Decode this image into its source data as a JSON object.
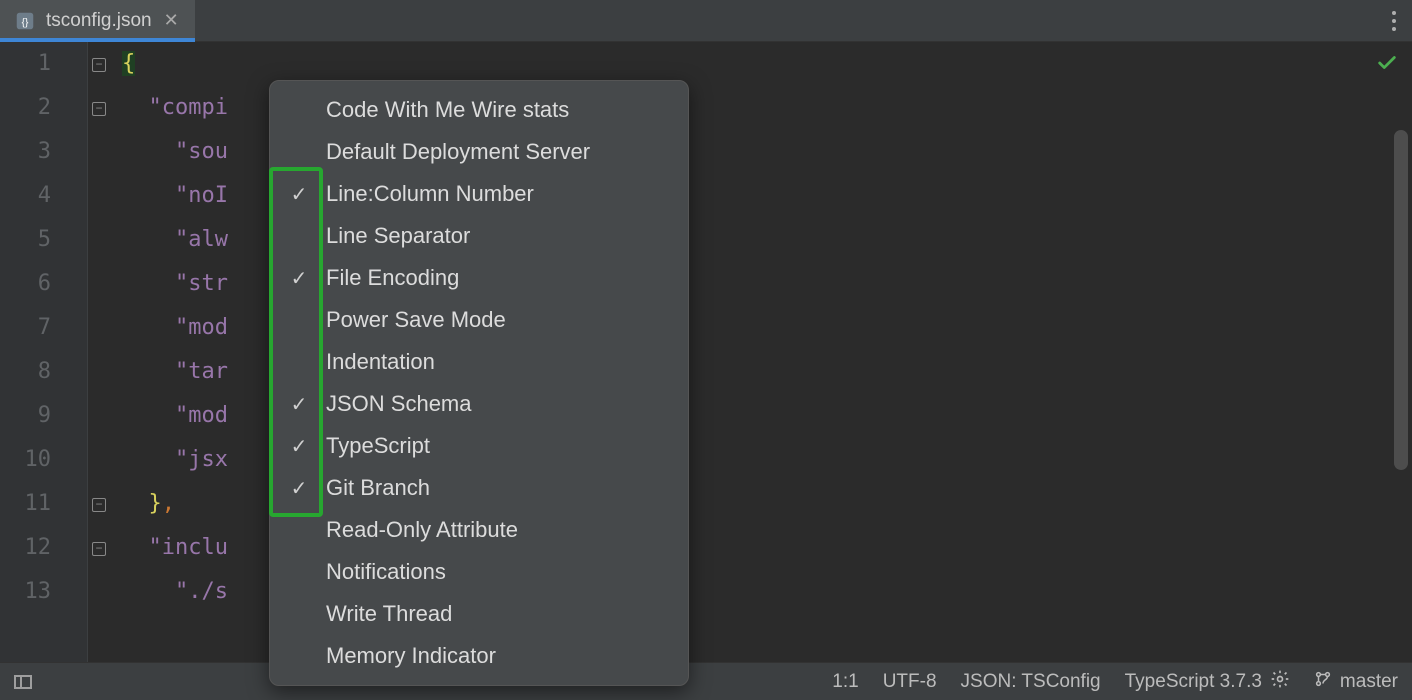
{
  "tab": {
    "title": "tsconfig.json",
    "icon_name": "ts-config-file-icon"
  },
  "editor": {
    "line_numbers": [
      "1",
      "2",
      "3",
      "4",
      "5",
      "6",
      "7",
      "8",
      "9",
      "10",
      "11",
      "12",
      "13"
    ],
    "lines": [
      {
        "segments": [
          {
            "t": "{",
            "c": "brace caret-hl"
          }
        ]
      },
      {
        "segments": [
          {
            "t": "  \"compi",
            "c": "key"
          }
        ]
      },
      {
        "segments": [
          {
            "t": "    \"sou",
            "c": "key"
          }
        ]
      },
      {
        "segments": [
          {
            "t": "    \"noI",
            "c": "key"
          }
        ]
      },
      {
        "segments": [
          {
            "t": "    \"alw",
            "c": "key"
          }
        ]
      },
      {
        "segments": [
          {
            "t": "    \"str",
            "c": "key"
          }
        ]
      },
      {
        "segments": [
          {
            "t": "    \"mod",
            "c": "key"
          }
        ]
      },
      {
        "segments": [
          {
            "t": "    \"tar",
            "c": "key"
          }
        ]
      },
      {
        "segments": [
          {
            "t": "    \"mod",
            "c": "key"
          }
        ]
      },
      {
        "segments": [
          {
            "t": "    \"jsx",
            "c": "key"
          }
        ]
      },
      {
        "segments": [
          {
            "t": "  }",
            "c": "brace"
          },
          {
            "t": ",",
            "c": "comma"
          }
        ]
      },
      {
        "segments": [
          {
            "t": "  \"inclu",
            "c": "key"
          }
        ]
      },
      {
        "segments": [
          {
            "t": "    \"./s",
            "c": "key"
          }
        ]
      }
    ]
  },
  "context_menu": {
    "items": [
      {
        "label": "Code With Me Wire stats",
        "checked": false
      },
      {
        "label": "Default Deployment Server",
        "checked": false
      },
      {
        "label": "Line:Column Number",
        "checked": true
      },
      {
        "label": "Line Separator",
        "checked": false
      },
      {
        "label": "File Encoding",
        "checked": true
      },
      {
        "label": "Power Save Mode",
        "checked": false
      },
      {
        "label": "Indentation",
        "checked": false
      },
      {
        "label": "JSON Schema",
        "checked": true
      },
      {
        "label": "TypeScript",
        "checked": true
      },
      {
        "label": "Git Branch",
        "checked": true
      },
      {
        "label": "Read-Only Attribute",
        "checked": false
      },
      {
        "label": "Notifications",
        "checked": false
      },
      {
        "label": "Write Thread",
        "checked": false
      },
      {
        "label": "Memory Indicator",
        "checked": false
      }
    ]
  },
  "status": {
    "line_col": "1:1",
    "encoding": "UTF-8",
    "schema": "JSON: TSConfig",
    "typescript": "TypeScript 3.7.3",
    "branch": "master"
  }
}
